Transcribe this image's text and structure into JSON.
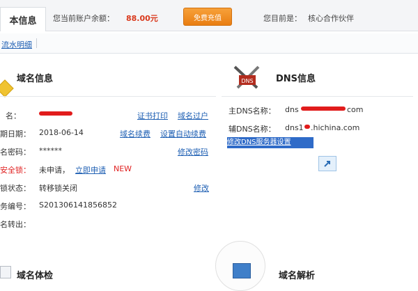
{
  "header": {
    "tab_label": "本信息",
    "balance_label": "您当前账户余额：",
    "balance_value": "88.00元",
    "charge_button": "免费充值",
    "identity_label": "您目前是：",
    "identity_value": "核心合作伙伴"
  },
  "subnav": {
    "link": "流水明细"
  },
  "domain_info": {
    "title": "域名信息",
    "rows": [
      {
        "label": "名：",
        "value": "",
        "links": [
          "证书打印",
          "域名过户"
        ]
      },
      {
        "label": "期日期：",
        "value": "2018-06-14",
        "links": [
          "域名续费",
          "设置自动续费"
        ]
      },
      {
        "label": "名密码：",
        "value": "******",
        "links": [
          "修改密码"
        ]
      },
      {
        "label": "安全锁：",
        "value": "未申请，",
        "action": "立即申请",
        "badge": "NEW"
      },
      {
        "label": "锁状态：",
        "value": "转移锁关闭",
        "links": [
          "修改"
        ]
      },
      {
        "label": "务编号：",
        "value": "S201306141856852"
      },
      {
        "label": "名转出：",
        "value": ""
      }
    ]
  },
  "dns_info": {
    "title": "DNS信息",
    "primary_label": "主DNS名称：",
    "primary_value_prefix": "dns",
    "primary_value_suffix": "com",
    "secondary_label": "辅DNS名称：",
    "secondary_value": "dns1",
    "secondary_value_suffix": ".hichina.com",
    "selected_link": "修改DNS服务器设置"
  },
  "bottom": {
    "left_title": "域名体检",
    "right_title": "域名解析"
  },
  "colors": {
    "link": "#1e5fb3",
    "alert": "#e02020",
    "accent_orange": "#e97e12",
    "selection": "#2f6bc8"
  }
}
